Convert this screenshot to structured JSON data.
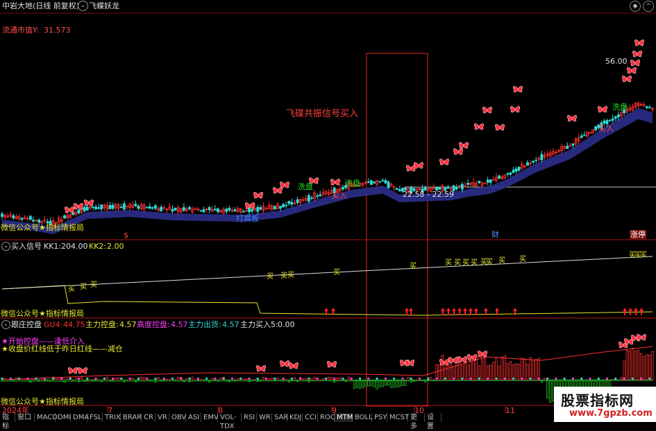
{
  "header": {
    "stock_title": "中岩大地(日线 前复权)",
    "indicator_name": "飞蝶妖龙",
    "float_value_label": "流通市值Y:",
    "float_value": "31.573"
  },
  "main_panel": {
    "annotation": "飞碟共振信号买入",
    "price_high_label": "56.00",
    "range_label": "22.58 - 22.59",
    "signals": {
      "wash": "洗盘",
      "buy": "买入",
      "break": "打真板",
      "limit": "涨停"
    },
    "watermark": "微信公众号★指标情报局",
    "markers": {
      "dollar": "$",
      "finance": "财"
    }
  },
  "panel2": {
    "title": "买入信号",
    "kk1_label": "KK1:",
    "kk1_value": "204.00",
    "kk2_label": "KK2:",
    "kk2_value": "2.00",
    "buy_char": "买",
    "watermark": "微信公众号★指标情报局"
  },
  "panel3": {
    "title": "跟庄控盘",
    "gu4_label": "GU4:",
    "gu4_value": "44.75",
    "ctrl_label": "主力控盘:",
    "ctrl_value": "4.57",
    "high_label": "高度控盘:",
    "high_value": "4.57",
    "out_label": "主力出货:",
    "out_value": "4.57",
    "buy5_label": "主力买入5:",
    "buy5_value": "0.00",
    "legend1": "★开始控盘——逢低介入",
    "legend2": "★收盘价红线低于昨日红线——减仓",
    "watermark": "微信公众号★指标情报局"
  },
  "time_axis": {
    "labels": [
      {
        "text": "2024年",
        "month": 6
      },
      {
        "text": "7",
        "month": 7
      },
      {
        "text": "8",
        "month": 8
      },
      {
        "text": "9",
        "month": 9
      },
      {
        "text": "10",
        "month": 10
      },
      {
        "text": "11",
        "month": 11
      }
    ]
  },
  "bottom_tabs": [
    "指标",
    "窗口",
    "MACD",
    "DMI",
    "DMA",
    "FSL",
    "TRIX",
    "BRAR",
    "CR",
    "VR",
    "OBV",
    "ASI",
    "EMV",
    "VOL-TDX",
    "RSI",
    "WR",
    "SAR",
    "KDJ",
    "CCI",
    "ROC",
    "MTM",
    "BOLL",
    "PSY",
    "MCST",
    "更多",
    "设置"
  ],
  "active_tab": "MTM",
  "site_watermark": {
    "title": "股票指标网",
    "url": "www.7gpzb.com"
  },
  "colors": {
    "up": "#ff3030",
    "down": "#30d8d8",
    "ribbon": "#2b2f8a",
    "green": "#20c020",
    "yellow": "#e8e830",
    "magenta": "#ff40ff",
    "red_frame": "#c02020"
  }
}
